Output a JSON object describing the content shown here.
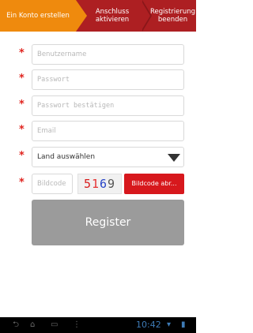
{
  "steps": [
    {
      "label": "Ein Konto erstellen"
    },
    {
      "label": "Anschluss\naktivieren"
    },
    {
      "label": "Registrierung\nbeenden"
    }
  ],
  "form": {
    "required_marker": "*",
    "username_placeholder": "Benutzername",
    "password_placeholder": "Passwort",
    "password_confirm_placeholder": "Passwort bestätigen",
    "email_placeholder": "Email",
    "country_select_value": "Land auswählen",
    "image_code_placeholder": "Bildcode",
    "captcha": {
      "chars": [
        "5",
        "1",
        "6",
        "9"
      ]
    },
    "image_code_button": "Bildcode abr...",
    "register_button": "Register"
  },
  "status_bar": {
    "time": "10:42",
    "icons": [
      "back-icon",
      "home-icon",
      "recent-apps-icon",
      "menu-icon",
      "wifi-icon",
      "battery-icon"
    ]
  },
  "colors": {
    "step_active": "#ef8a0d",
    "step_inactive": "#ad1f22",
    "required_star": "#e0241f",
    "abort_button": "#d7181d",
    "register_button": "#9b9b9b"
  }
}
